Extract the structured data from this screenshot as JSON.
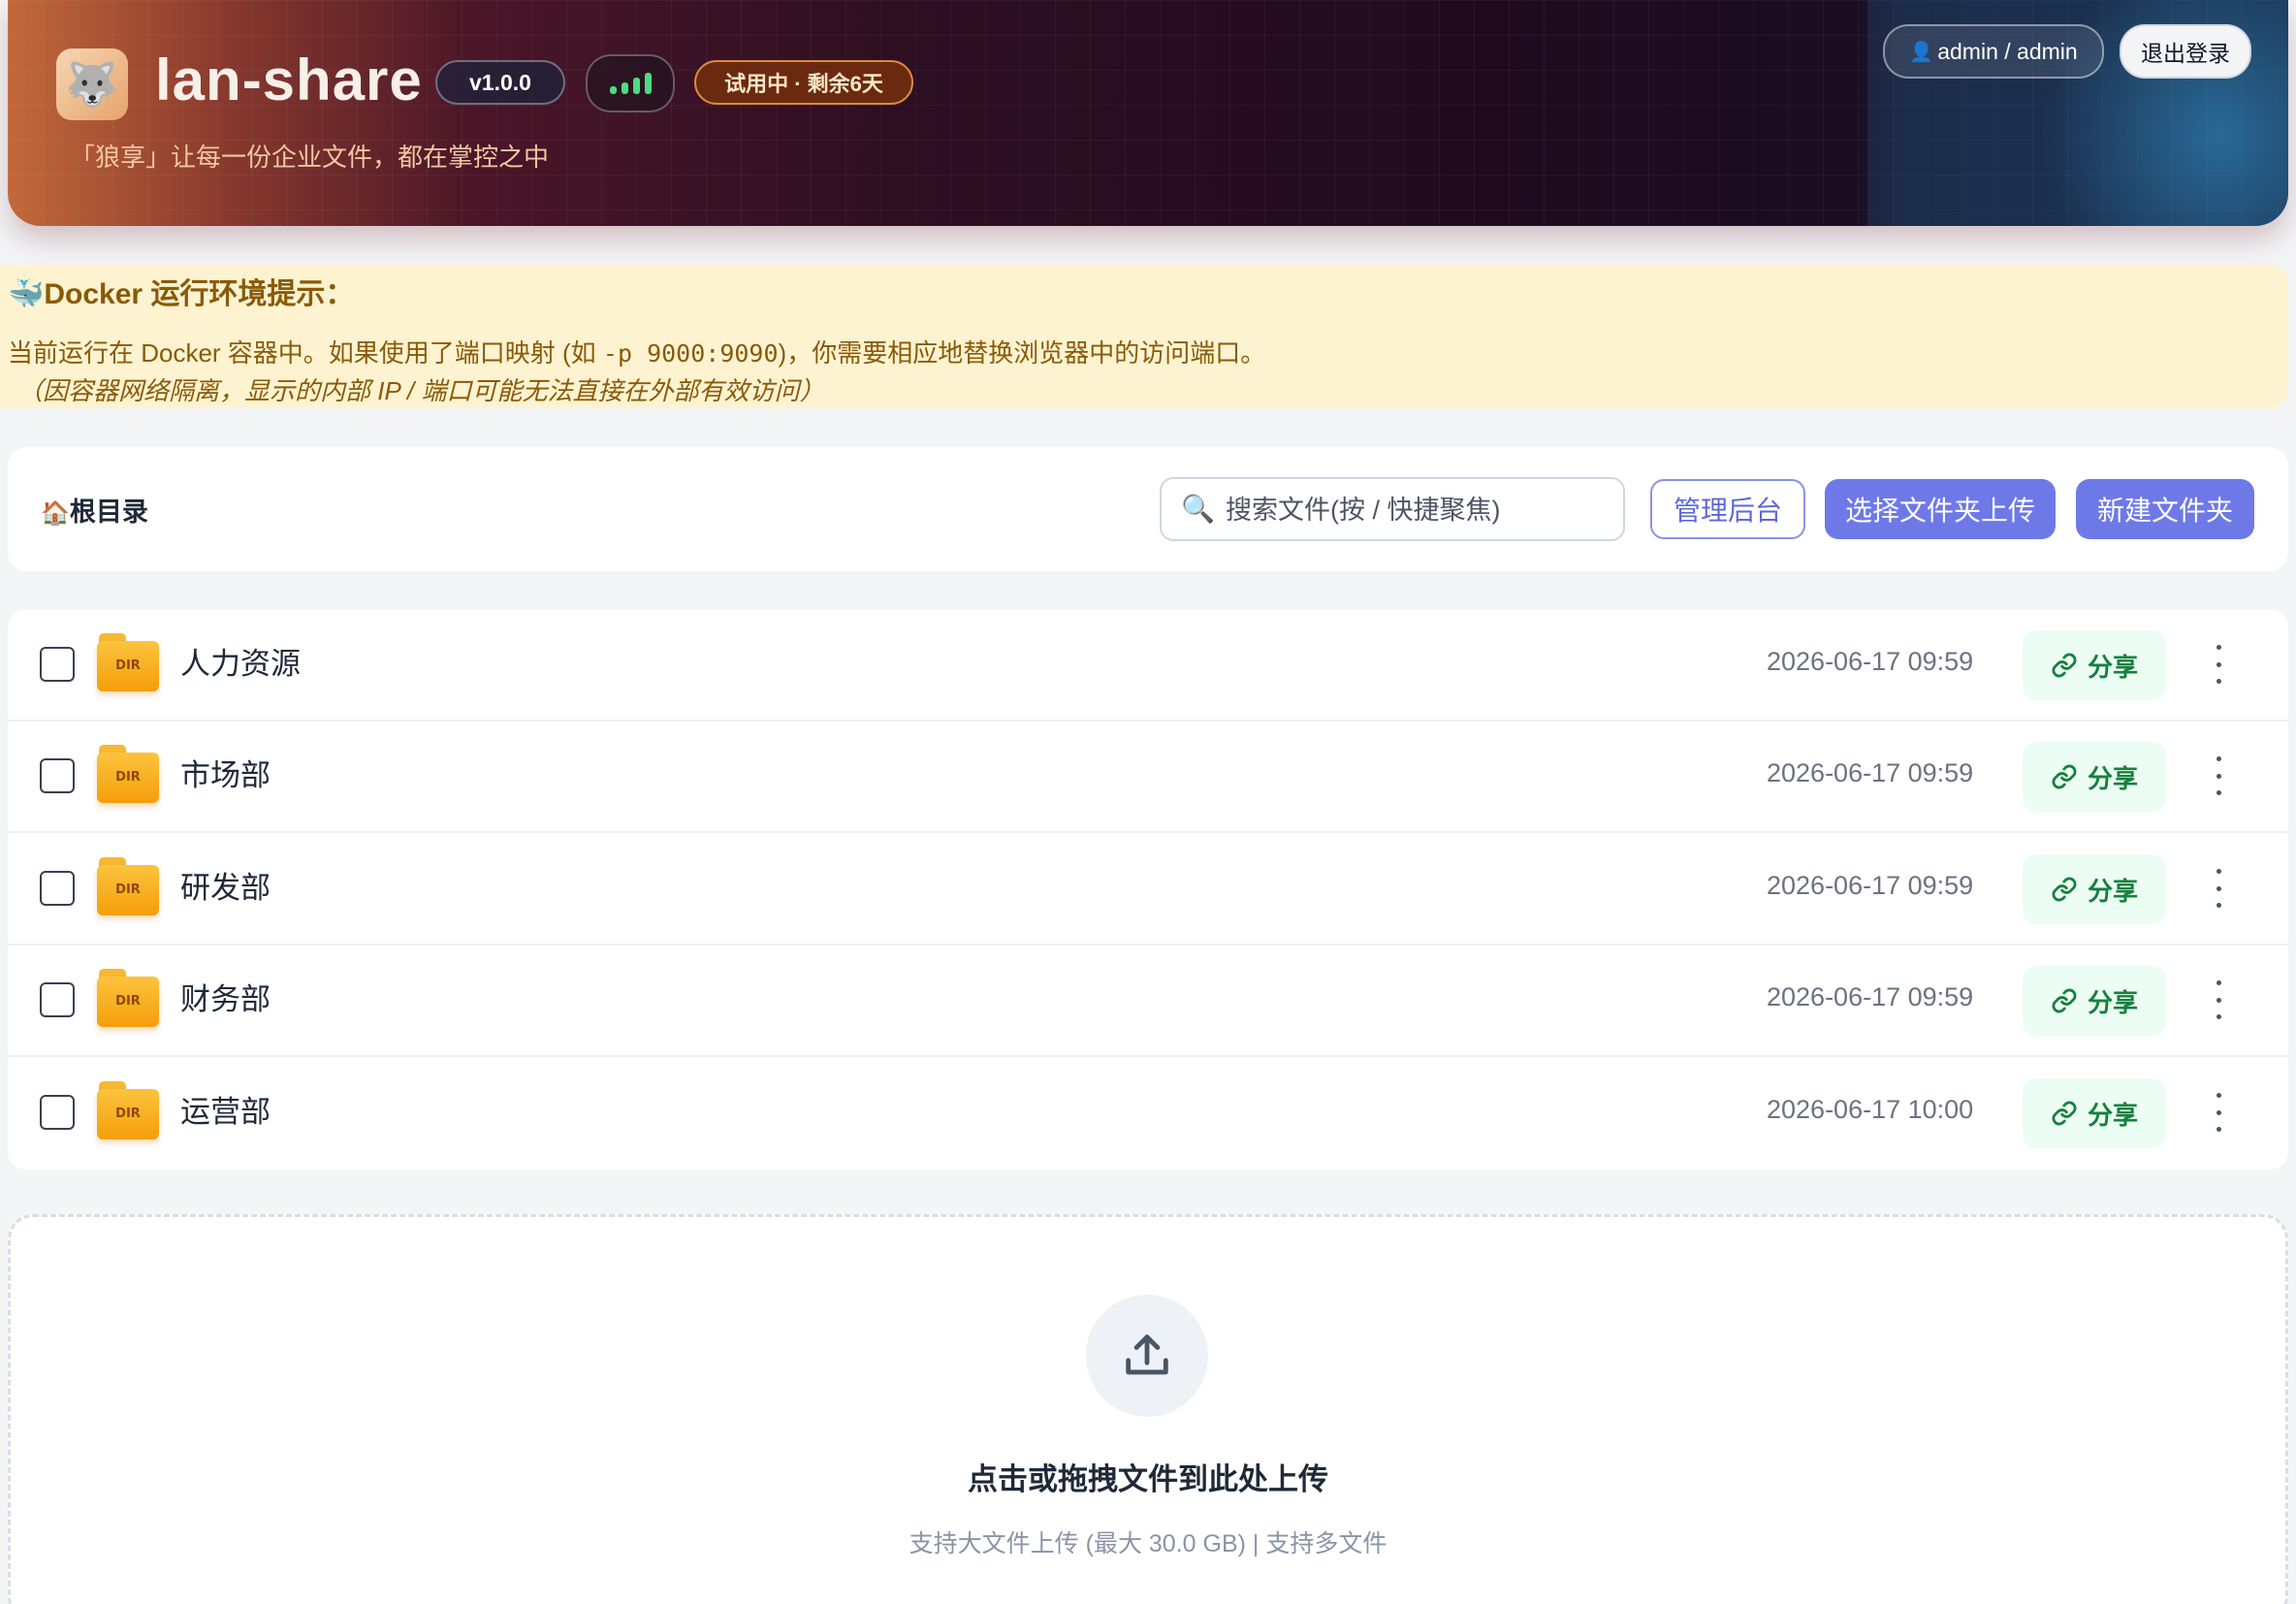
{
  "header": {
    "app_name": "lan-share",
    "version": "v1.0.0",
    "trial": "试用中 · 剩余6天",
    "tagline": "「狼享」让每一份企业文件，都在掌控之中",
    "user": "admin / admin",
    "logout": "退出登录",
    "user_icon": "user-icon",
    "signal_icon": "signal-bars-icon",
    "signal_color": "#4ade80"
  },
  "notice": {
    "title": "Docker 运行环境提示：",
    "line1_prefix": "当前运行在 Docker 容器中。如果使用了端口映射 (如 ",
    "line1_code": "-p 9000:9090",
    "line1_suffix": ")，你需要相应地替换浏览器中的访问端口。",
    "line2": "（因容器网络隔离，显示的内部 IP / 端口可能无法直接在外部有效访问）",
    "icon": "whale-icon"
  },
  "toolbar": {
    "breadcrumb": "根目录",
    "breadcrumb_icon": "home-icon",
    "search_placeholder": "搜索文件(按 / 快捷聚焦)",
    "admin_label": "管理后台",
    "upload_folder_label": "选择文件夹上传",
    "new_folder_label": "新建文件夹",
    "accent": "#6e79e8"
  },
  "files": [
    {
      "name": "人力资源",
      "date": "2026-06-17 09:59",
      "type": "DIR",
      "share": "分享"
    },
    {
      "name": "市场部",
      "date": "2026-06-17 09:59",
      "type": "DIR",
      "share": "分享"
    },
    {
      "name": "研发部",
      "date": "2026-06-17 09:59",
      "type": "DIR",
      "share": "分享"
    },
    {
      "name": "财务部",
      "date": "2026-06-17 09:59",
      "type": "DIR",
      "share": "分享"
    },
    {
      "name": "运营部",
      "date": "2026-06-17 10:00",
      "type": "DIR",
      "share": "分享"
    }
  ],
  "dropzone": {
    "title": "点击或拖拽文件到此处上传",
    "subtitle": "支持大文件上传 (最大 30.0 GB) | 支持多文件",
    "icon": "upload-icon"
  }
}
